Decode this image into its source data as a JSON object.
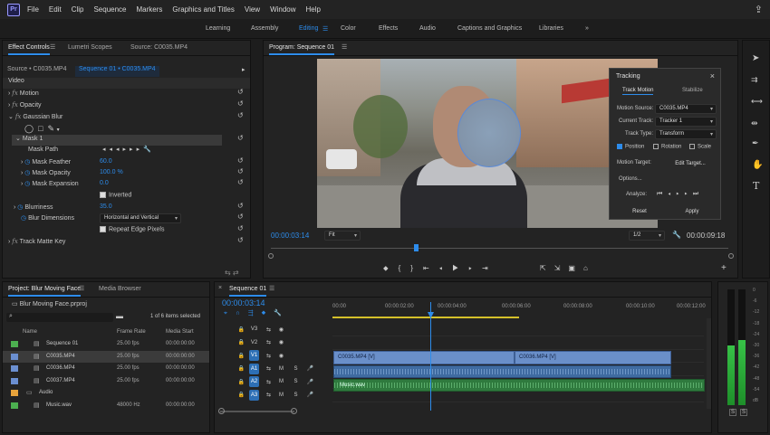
{
  "app": {
    "logo": "Pr"
  },
  "menu": [
    "File",
    "Edit",
    "Clip",
    "Sequence",
    "Markers",
    "Graphics and Titles",
    "View",
    "Window",
    "Help"
  ],
  "workspaces": [
    "Learning",
    "Assembly",
    "Editing",
    "Color",
    "Effects",
    "Audio",
    "Captions and Graphics",
    "Libraries"
  ],
  "effect_controls": {
    "tabs": [
      "Effect Controls",
      "Lumetri Scopes",
      "Source: C0035.MP4"
    ],
    "source": "Source • C0035.MP4",
    "sequence": "Sequence 01 • C0035.MP4",
    "video_label": "Video",
    "motion": "Motion",
    "opacity": "Opacity",
    "blur": "Gaussian Blur",
    "mask": "Mask 1",
    "mask_path": "Mask Path",
    "feather_label": "Mask Feather",
    "feather_value": "60.0",
    "mask_opacity_label": "Mask Opacity",
    "mask_opacity_value": "100.0 %",
    "expansion_label": "Mask Expansion",
    "expansion_value": "0.0",
    "inverted": "Inverted",
    "blurriness_label": "Blurriness",
    "blurriness_value": "35.0",
    "dimensions_label": "Blur Dimensions",
    "dimensions_value": "Horizontal and Vertical",
    "repeat_label": "Repeat Edge Pixels",
    "track_matte": "Track Matte Key"
  },
  "program": {
    "title": "Program: Sequence 01",
    "timecode": "00:00:03:14",
    "fit": "Fit",
    "res": "1/2",
    "duration": "00:00:09:18"
  },
  "tracking": {
    "title": "Tracking",
    "tab1": "Track Motion",
    "tab2": "Stabilize",
    "motion_source_label": "Motion Source:",
    "motion_source": "C0035.MP4",
    "current_track_label": "Current Track:",
    "current_track": "Tracker 1",
    "track_type_label": "Track Type:",
    "track_type": "Transform",
    "position": "Position",
    "rotation": "Rotation",
    "scale": "Scale",
    "motion_target_label": "Motion Target:",
    "edit_target": "Edit Target...",
    "options": "Options...",
    "analyze": "Analyze:",
    "reset": "Reset",
    "apply": "Apply"
  },
  "project": {
    "tabs": [
      "Project: Blur Moving Face",
      "Media Browser"
    ],
    "file": "Blur Moving Face.prproj",
    "selected": "1 of 6 items selected",
    "headers": [
      "Name",
      "Frame Rate",
      "Media Start"
    ],
    "items": [
      {
        "name": "Sequence 01",
        "rate": "25.00 fps",
        "start": "00:00:00:00",
        "color": "#4caf50"
      },
      {
        "name": "C0035.MP4",
        "rate": "25.00 fps",
        "start": "00:00:00:00",
        "color": "#6b8fd0"
      },
      {
        "name": "C0036.MP4",
        "rate": "25.00 fps",
        "start": "00:00:00:00",
        "color": "#6b8fd0"
      },
      {
        "name": "C0037.MP4",
        "rate": "25.00 fps",
        "start": "00:00:00:00",
        "color": "#6b8fd0"
      },
      {
        "name": "Audio",
        "rate": "",
        "start": "",
        "color": "#e8a33b"
      },
      {
        "name": "Music.wav",
        "rate": "48000 Hz",
        "start": "00:00:00:00",
        "color": "#4caf50"
      }
    ]
  },
  "timeline": {
    "tab": "Sequence 01",
    "timecode": "00:00:03:14",
    "ruler": [
      "00:00",
      "00:00:02:00",
      "00:00:04:00",
      "00:00:06:00",
      "00:00:08:00",
      "00:00:10:00",
      "00:00:12:00"
    ],
    "tracks": [
      "V3",
      "V2",
      "V1",
      "A1",
      "A2",
      "A3"
    ],
    "clip1": "C0035.MP4 [V]",
    "clip2": "C0036.MP4 [V]",
    "music": "Music.wav"
  },
  "meters": {
    "scale": [
      "0",
      "-6",
      "-12",
      "-18",
      "-24",
      "-30",
      "-36",
      "-42",
      "-48",
      "-54",
      "dB"
    ],
    "solo": "S"
  }
}
